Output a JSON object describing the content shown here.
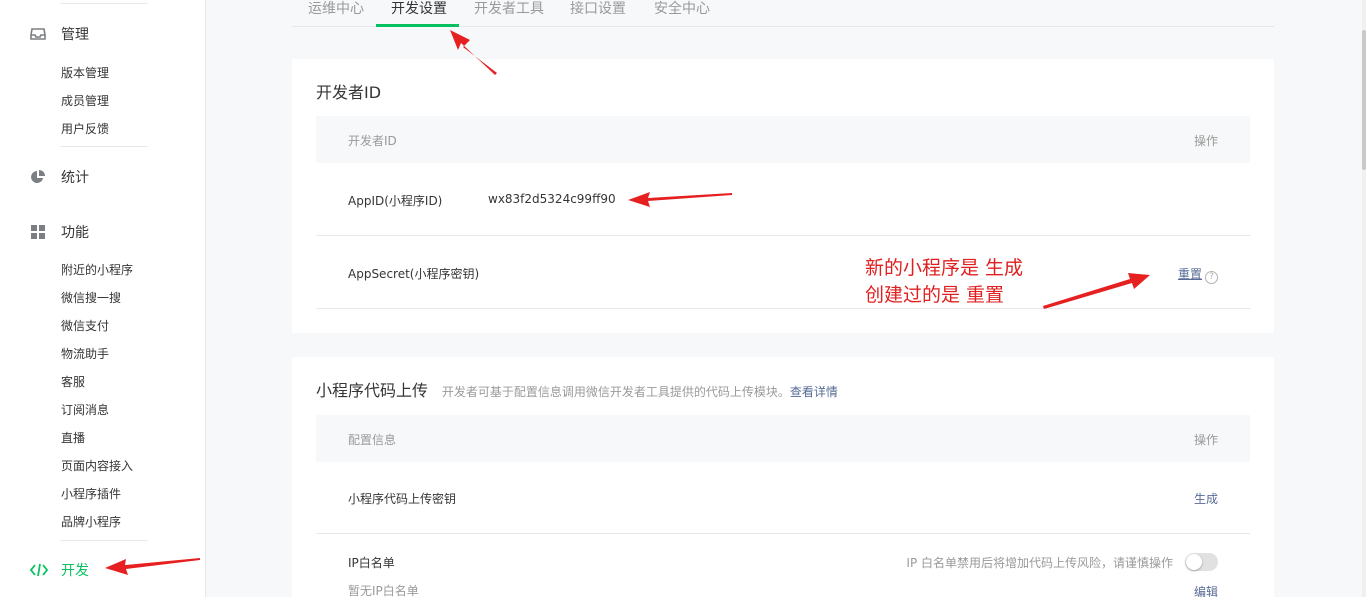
{
  "sidebar": {
    "groups": [
      {
        "label": "管理",
        "icon": "inbox-icon",
        "items": [
          "版本管理",
          "成员管理",
          "用户反馈"
        ]
      },
      {
        "label": "统计",
        "icon": "pie-chart-icon",
        "items": []
      },
      {
        "label": "功能",
        "icon": "grid-icon",
        "items": [
          "附近的小程序",
          "微信搜一搜",
          "微信支付",
          "物流助手",
          "客服",
          "订阅消息",
          "直播",
          "页面内容接入",
          "小程序插件",
          "品牌小程序"
        ]
      },
      {
        "label": "开发",
        "icon": "code-icon",
        "items": []
      }
    ],
    "active": "开发"
  },
  "tabs": [
    "运维中心",
    "开发设置",
    "开发者工具",
    "接口设置",
    "安全中心"
  ],
  "active_tab": "开发设置",
  "developer_id": {
    "title": "开发者ID",
    "header": {
      "col1": "开发者ID",
      "col2": "操作"
    },
    "rows": [
      {
        "label": "AppID(小程序ID)",
        "value": "wx83f2d5324c99ff90"
      },
      {
        "label": "AppSecret(小程序密钥)",
        "action": "重置",
        "help": "?"
      }
    ]
  },
  "code_upload": {
    "title": "小程序代码上传",
    "desc": "开发者可基于配置信息调用微信开发者工具提供的代码上传模块。",
    "desc_link": "查看详情",
    "header": {
      "col1": "配置信息",
      "col2": "操作"
    },
    "rows": [
      {
        "label": "小程序代码上传密钥",
        "action": "生成"
      },
      {
        "label": "IP白名单",
        "sublabel": "暂无IP白名单",
        "note": "IP 白名单禁用后将增加代码上传风险，请谨慎操作",
        "action": "编辑"
      }
    ]
  },
  "annotation": {
    "line1": "新的小程序是 生成",
    "line2": "创建过的是 重置"
  },
  "colors": {
    "accent": "#07c160",
    "link": "#576b95",
    "annotation": "#e02020"
  }
}
